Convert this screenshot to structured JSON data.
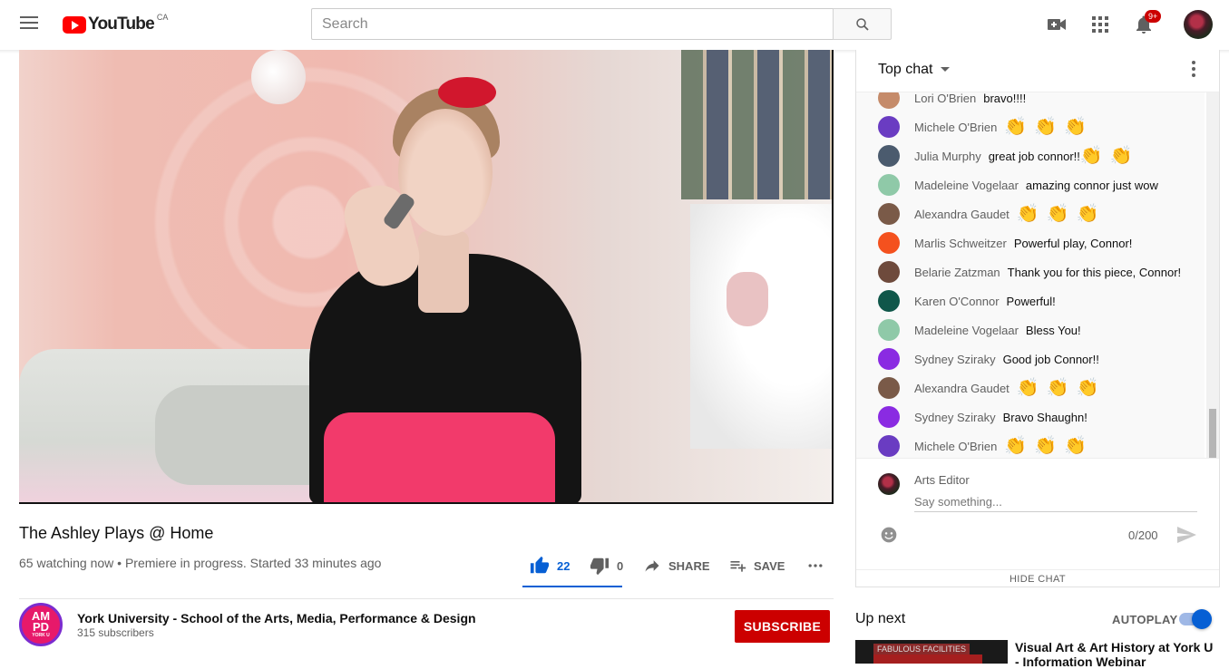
{
  "header": {
    "logo_text": "YouTube",
    "country_code": "CA",
    "search_placeholder": "Search",
    "notification_count": "9+"
  },
  "video": {
    "title": "The Ashley Plays @ Home",
    "meta": "65 watching now • Premiere in progress. Started 33 minutes ago",
    "likes": "22",
    "dislikes": "0",
    "share_label": "SHARE",
    "save_label": "SAVE"
  },
  "channel": {
    "avatar_line1": "AM",
    "avatar_line2": "PD",
    "avatar_line3": "YORK U",
    "name": "York University - School of the Arts, Media, Performance & Design",
    "subscribers": "315 subscribers",
    "subscribe_label": "SUBSCRIBE"
  },
  "chat": {
    "title": "Top chat",
    "messages": [
      {
        "author": "Lori O'Brien",
        "text": "bravo!!!!",
        "avatar_color": "#c58b6a",
        "claps": ""
      },
      {
        "author": "Michele O'Brien",
        "text": "",
        "avatar_color": "#6a3cc2",
        "claps": "👏👏👏"
      },
      {
        "author": "Julia Murphy",
        "text": "great job connor!!",
        "avatar_color": "#4b5b6e",
        "claps": "👏👏"
      },
      {
        "author": "Madeleine Vogelaar",
        "text": "amazing connor just wow",
        "avatar_color": "#8fc9a8",
        "claps": ""
      },
      {
        "author": "Alexandra Gaudet",
        "text": "",
        "avatar_color": "#7a5a48",
        "claps": "👏👏👏"
      },
      {
        "author": "Marlis Schweitzer",
        "text": "Powerful play, Connor!",
        "avatar_color": "#f4511e",
        "claps": ""
      },
      {
        "author": "Belarie Zatzman",
        "text": "Thank you for this piece, Connor!",
        "avatar_color": "#6e4a3c",
        "claps": ""
      },
      {
        "author": "Karen O'Connor",
        "text": "Powerful!",
        "avatar_color": "#10574a",
        "claps": ""
      },
      {
        "author": "Madeleine Vogelaar",
        "text": "Bless You!",
        "avatar_color": "#8fc9a8",
        "claps": ""
      },
      {
        "author": "Sydney Sziraky",
        "text": "Good job Connor!!",
        "avatar_color": "#8a2be2",
        "claps": ""
      },
      {
        "author": "Alexandra Gaudet",
        "text": "",
        "avatar_color": "#7a5a48",
        "claps": "👏👏👏"
      },
      {
        "author": "Sydney Sziraky",
        "text": "Bravo Shaughn!",
        "avatar_color": "#8a2be2",
        "claps": ""
      },
      {
        "author": "Michele O'Brien",
        "text": "",
        "avatar_color": "#6a3cc2",
        "claps": "👏👏👏"
      }
    ],
    "input_author": "Arts Editor",
    "input_placeholder": "Say something...",
    "counter": "0/200",
    "hide_label": "HIDE CHAT"
  },
  "upnext": {
    "label": "Up next",
    "autoplay_label": "AUTOPLAY",
    "autoplay_on": true,
    "thumb_caption": "FABULOUS FACILITIES",
    "video_title": "Visual Art & Art History at York U - Information Webinar"
  },
  "colors": {
    "brand_red": "#ff0000",
    "subscribe_red": "#cc0000",
    "like_blue": "#065fd4"
  }
}
